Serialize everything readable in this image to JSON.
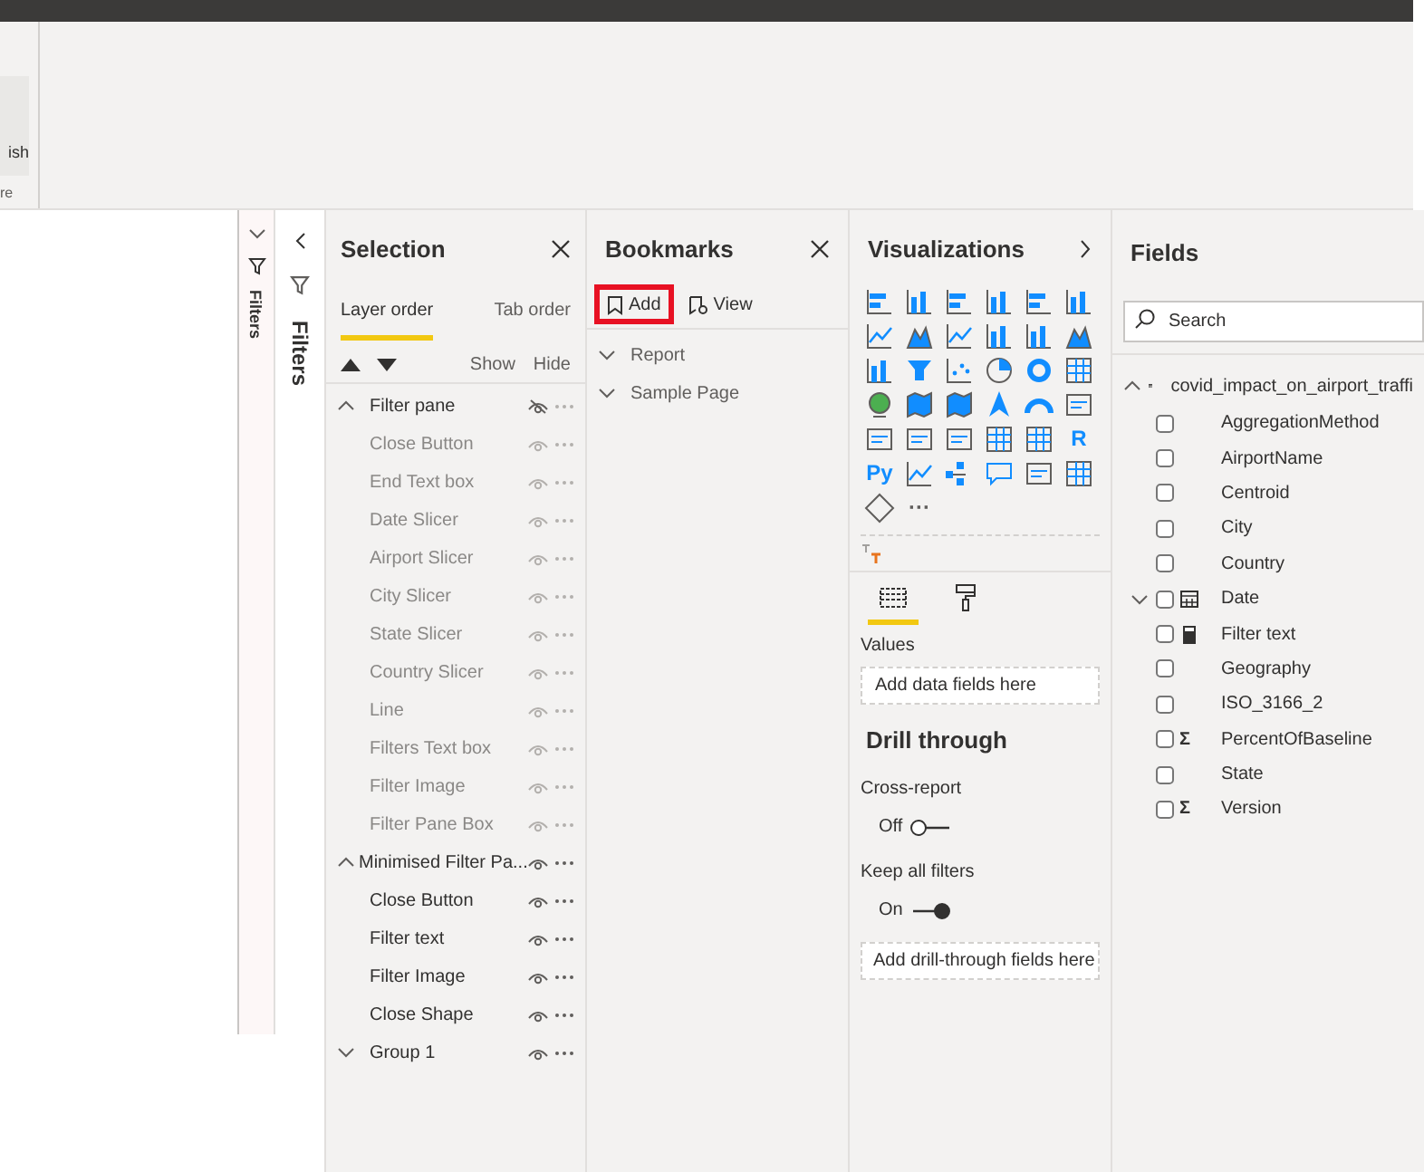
{
  "ribbon": {
    "button_label": "ish",
    "group_label": "re"
  },
  "filters_strips": [
    {
      "label": "Filters"
    },
    {
      "label": "Filters"
    }
  ],
  "selection": {
    "title": "Selection",
    "tabs": [
      {
        "label": "Layer order",
        "selected": true
      },
      {
        "label": "Tab order",
        "selected": false
      }
    ],
    "show_label": "Show",
    "hide_label": "Hide",
    "items": [
      {
        "name": "Filter pane",
        "visible": false,
        "expanded": true,
        "children": [
          {
            "name": "Close Button",
            "visible": true
          },
          {
            "name": "End Text box",
            "visible": true
          },
          {
            "name": "Date Slicer",
            "visible": true
          },
          {
            "name": "Airport Slicer",
            "visible": true
          },
          {
            "name": "City Slicer",
            "visible": true
          },
          {
            "name": "State Slicer",
            "visible": true
          },
          {
            "name": "Country Slicer",
            "visible": true
          },
          {
            "name": "Line",
            "visible": true
          },
          {
            "name": "Filters Text box",
            "visible": true
          },
          {
            "name": "Filter Image",
            "visible": true
          },
          {
            "name": "Filter Pane Box",
            "visible": true
          }
        ]
      },
      {
        "name": "Minimised Filter Pa...",
        "visible": true,
        "expanded": true,
        "children": [
          {
            "name": "Close Button",
            "visible": true
          },
          {
            "name": "Filter text",
            "visible": true
          },
          {
            "name": "Filter Image",
            "visible": true
          },
          {
            "name": "Close Shape",
            "visible": true
          }
        ]
      },
      {
        "name": "Group 1",
        "visible": true,
        "expanded": false
      }
    ]
  },
  "bookmarks": {
    "title": "Bookmarks",
    "add": {
      "label": "Add",
      "highlighted": true
    },
    "view": {
      "label": "View"
    },
    "groups": [
      {
        "name": "Report",
        "expanded": false
      },
      {
        "name": "Sample Page",
        "expanded": false
      }
    ]
  },
  "visualizations": {
    "title": "Visualizations",
    "icons": [
      {
        "kind": "hbar"
      },
      {
        "kind": "col"
      },
      {
        "kind": "hbar"
      },
      {
        "kind": "col"
      },
      {
        "kind": "hbar"
      },
      {
        "kind": "col"
      },
      {
        "kind": "line"
      },
      {
        "kind": "area"
      },
      {
        "kind": "line"
      },
      {
        "kind": "col"
      },
      {
        "kind": "col"
      },
      {
        "kind": "area"
      },
      {
        "kind": "col"
      },
      {
        "kind": "funnel"
      },
      {
        "kind": "scatter"
      },
      {
        "kind": "pie"
      },
      {
        "kind": "donut"
      },
      {
        "kind": "grid"
      },
      {
        "kind": "globe"
      },
      {
        "kind": "map"
      },
      {
        "kind": "map"
      },
      {
        "kind": "arrow"
      },
      {
        "kind": "gauge"
      },
      {
        "kind": "card"
      },
      {
        "kind": "card"
      },
      {
        "kind": "card"
      },
      {
        "kind": "card"
      },
      {
        "kind": "grid"
      },
      {
        "kind": "grid"
      },
      {
        "kind": "glyph",
        "text": "R"
      },
      {
        "kind": "glyph",
        "text": "Py"
      },
      {
        "kind": "line"
      },
      {
        "kind": "tree"
      },
      {
        "kind": "bubble"
      },
      {
        "kind": "card"
      },
      {
        "kind": "grid"
      },
      {
        "kind": "shape"
      },
      {
        "kind": "glyph",
        "text": "···"
      }
    ],
    "tabs": [
      {
        "kind": "fields",
        "selected": true
      },
      {
        "kind": "format",
        "selected": false
      }
    ],
    "values_label": "Values",
    "values_placeholder": "Add data fields here",
    "drill_title": "Drill through",
    "toggles": [
      {
        "label": "Cross-report",
        "state_label": "Off",
        "on": false
      },
      {
        "label": "Keep all filters",
        "state_label": "On",
        "on": true
      }
    ],
    "drill_placeholder": "Add drill-through fields here"
  },
  "fields": {
    "title": "Fields",
    "search_placeholder": "Search",
    "table": {
      "name": "covid_impact_on_airport_traffi",
      "expanded": true,
      "columns": [
        {
          "name": "AggregationMethod",
          "kind": "plain",
          "checked": false
        },
        {
          "name": "AirportName",
          "kind": "plain",
          "checked": false
        },
        {
          "name": "Centroid",
          "kind": "plain",
          "checked": false
        },
        {
          "name": "City",
          "kind": "plain",
          "checked": false
        },
        {
          "name": "Country",
          "kind": "plain",
          "checked": false
        },
        {
          "name": "Date",
          "kind": "date",
          "checked": false,
          "expanded": false
        },
        {
          "name": "Filter text",
          "kind": "measure",
          "checked": false
        },
        {
          "name": "Geography",
          "kind": "plain",
          "checked": false
        },
        {
          "name": "ISO_3166_2",
          "kind": "plain",
          "checked": false
        },
        {
          "name": "PercentOfBaseline",
          "kind": "sum",
          "symbol": "Σ",
          "checked": false
        },
        {
          "name": "State",
          "kind": "plain",
          "checked": false
        },
        {
          "name": "Version",
          "kind": "sum",
          "symbol": "Σ",
          "checked": false
        }
      ]
    }
  }
}
